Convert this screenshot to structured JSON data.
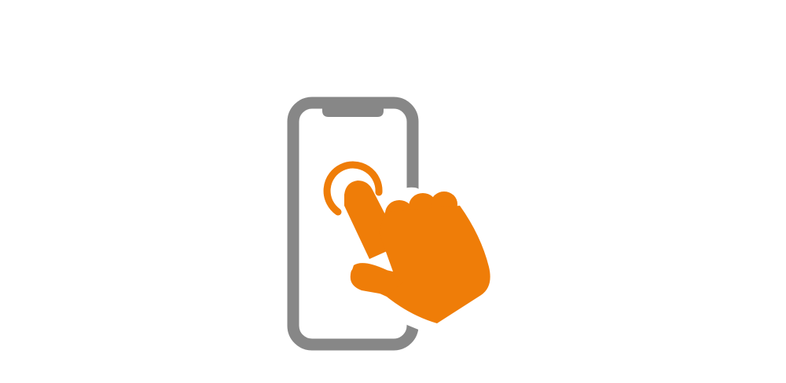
{
  "illustration": {
    "icon": "phone-tap-icon",
    "phone_icon": "smartphone-icon",
    "hand_icon": "pointing-hand-icon",
    "touch_icon": "touch-ripple-icon"
  },
  "colors": {
    "background": "#ffffff",
    "phone_frame": "#878787",
    "accent": "#ef7d08"
  }
}
